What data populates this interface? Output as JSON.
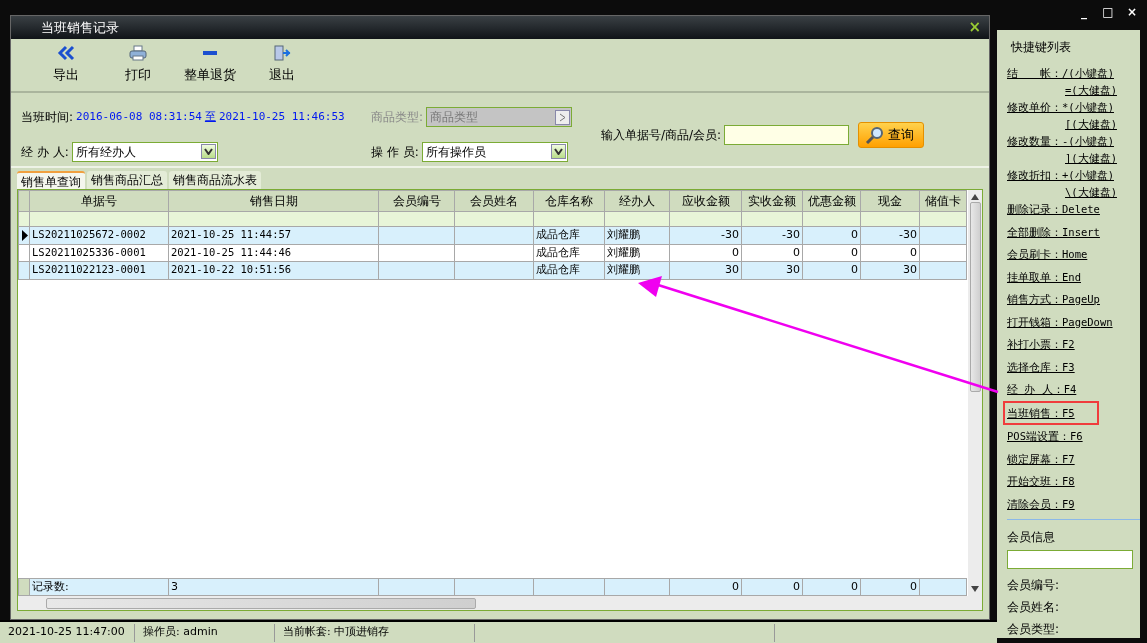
{
  "window": {
    "controls": [
      "_",
      "□",
      "×"
    ]
  },
  "dialog": {
    "title": "当班销售记录",
    "close": "×"
  },
  "toolbar": [
    {
      "kind": "export",
      "label": "导出"
    },
    {
      "kind": "print",
      "label": "打印"
    },
    {
      "kind": "return",
      "label": "整单退货"
    },
    {
      "kind": "exit",
      "label": "退出"
    }
  ],
  "filters": {
    "shift_label": "当班时间:",
    "shift_start": "2016-06-08 08:31:54",
    "shift_to": "至",
    "shift_end": "2021-10-25 11:46:53",
    "category_label": "商品类型:",
    "category_value": "商品类型",
    "category_disabled": true,
    "handler_label": "经 办 人:",
    "handler_value": "所有经办人",
    "operator_label": "操 作 员:",
    "operator_value": "所有操作员",
    "search_label": "输入单据号/商品/会员:",
    "search_button": "查询"
  },
  "tabs": [
    {
      "label": "销售单查询",
      "selected": true
    },
    {
      "label": "销售商品汇总",
      "selected": false
    },
    {
      "label": "销售商品流水表",
      "selected": false
    }
  ],
  "table": {
    "columns": [
      "单据号",
      "销售日期",
      "会员编号",
      "会员姓名",
      "仓库名称",
      "经办人",
      "应收金额",
      "实收金额",
      "优惠金额",
      "现金",
      "储值卡"
    ],
    "rows": [
      {
        "selected": true,
        "cells": [
          "LS20211025672-0002",
          "2021-10-25 11:44:57",
          null,
          null,
          "成品仓库",
          "刘耀鹏",
          "-30",
          "-30",
          "0",
          "-30"
        ]
      },
      {
        "selected": false,
        "cells": [
          "LS20211025336-0001",
          "2021-10-25 11:44:46",
          null,
          null,
          "成品仓库",
          "刘耀鹏",
          "0",
          "0",
          "0",
          "0"
        ]
      },
      {
        "selected": false,
        "cells": [
          "LS20211022123-0001",
          "2021-10-22 10:51:56",
          null,
          null,
          "成品仓库",
          "刘耀鹏",
          "30",
          "30",
          "0",
          "30"
        ]
      }
    ],
    "footer": {
      "label": "记录数:",
      "count": "3",
      "totals": [
        "0",
        "0",
        "0",
        "0"
      ]
    }
  },
  "status_bar": [
    "2021-10-25 11:47:00",
    "操作员: admin",
    "当前帐套: 中顶进销存"
  ],
  "shortcuts": {
    "title": "快捷键列表",
    "items": [
      {
        "text": "结　　帐：/(小键盘)",
        "extra": "=(大健盘)",
        "highlighted": false
      },
      {
        "text": "修改单价：*(小键盘)",
        "extra": "[(大健盘)",
        "highlighted": false
      },
      {
        "text": "修改数量：-(小键盘)",
        "extra": "](大健盘)",
        "highlighted": false
      },
      {
        "text": "修改折扣：+(小键盘)",
        "extra": "\\(大健盘)",
        "highlighted": false
      },
      {
        "text": "删除记录：Delete",
        "highlighted": false
      },
      {
        "text": "全部删除：Insert",
        "highlighted": false
      },
      {
        "text": "会员刷卡：Home",
        "highlighted": false
      },
      {
        "text": "挂单取单：End",
        "highlighted": false
      },
      {
        "text": "销售方式：PageUp",
        "highlighted": false
      },
      {
        "text": "打开钱箱：PageDown",
        "highlighted": false
      },
      {
        "text": "补打小票：F2",
        "highlighted": false
      },
      {
        "text": "选择仓库：F3",
        "highlighted": false
      },
      {
        "text": "经 办 人：F4",
        "highlighted": false
      },
      {
        "text": "当班销售：F5",
        "highlighted": true
      },
      {
        "text": "POS端设置：F6",
        "highlighted": false
      },
      {
        "text": "锁定屏幕：F7",
        "highlighted": false
      },
      {
        "text": "开始交班：F8",
        "highlighted": false
      },
      {
        "text": "清除会员：F9",
        "highlighted": false
      }
    ]
  },
  "member": {
    "title": "会员信息",
    "fields": [
      "会员编号:",
      "会员姓名:",
      "会员类型:"
    ]
  }
}
